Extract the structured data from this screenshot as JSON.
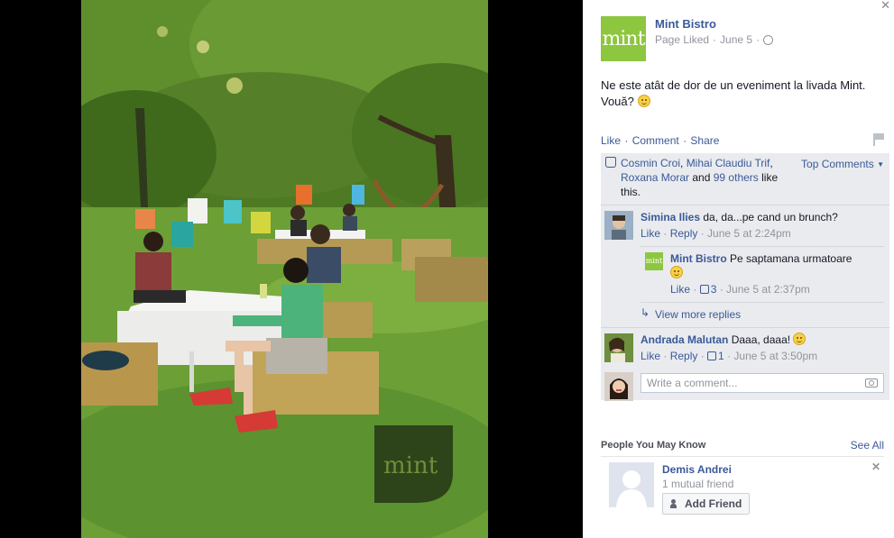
{
  "photo": {
    "watermark": "mint"
  },
  "page": {
    "logo_text": "mint",
    "name": "Mint Bistro",
    "liked_label": "Page Liked",
    "date": "June 5",
    "privacy_icon": "globe-icon"
  },
  "post": {
    "text": "Ne este atât de dor de un eveniment la livada Mint. Vouă?"
  },
  "actions": {
    "like": "Like",
    "comment": "Comment",
    "share": "Share"
  },
  "likes": {
    "names": [
      "Cosmin Croi",
      "Mihai Claudiu Trif",
      "Roxana Morar"
    ],
    "others": "99 others",
    "and": "and",
    "suffix": "like this.",
    "sort_label": "Top Comments"
  },
  "comments": [
    {
      "author": "Simina Ilies",
      "text": "da, da...pe cand un brunch?",
      "like": "Like",
      "reply": "Reply",
      "time": "June 5 at 2:24pm",
      "replies": [
        {
          "author": "Mint Bistro",
          "text": "Pe saptamana urmatoare",
          "like": "Like",
          "likes": "3",
          "time": "June 5 at 2:37pm"
        }
      ],
      "more_replies": "View more replies"
    },
    {
      "author": "Andrada Malutan",
      "text": "Daaa, daaa!",
      "like": "Like",
      "reply": "Reply",
      "likes": "1",
      "time": "June 5 at 3:50pm"
    }
  ],
  "write": {
    "placeholder": "Write a comment..."
  },
  "pymk": {
    "title": "People You May Know",
    "see_all": "See All",
    "person": {
      "name": "Demis Andrei",
      "mutual": "1 mutual friend",
      "button": "Add Friend"
    }
  },
  "colors": {
    "link": "#3b5998",
    "brand_green": "#8dc63f",
    "ufi_bg": "#e9ebee"
  }
}
